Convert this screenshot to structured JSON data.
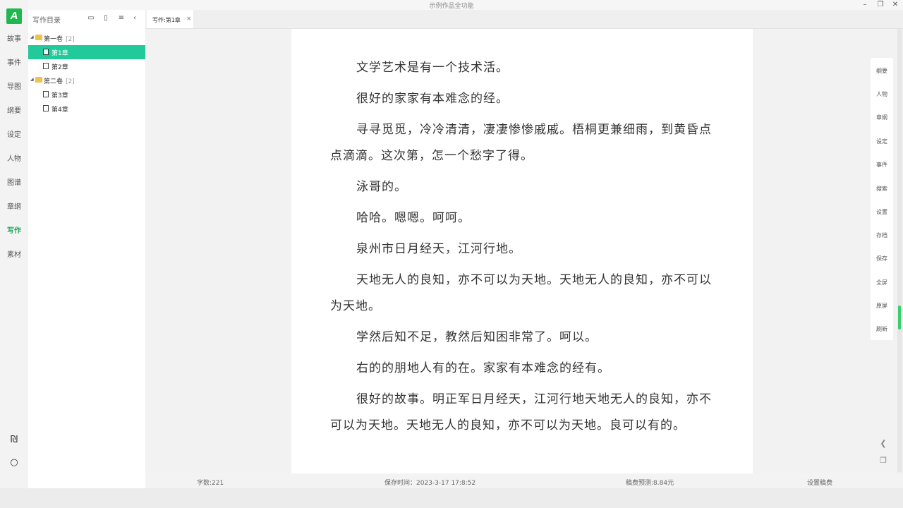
{
  "window": {
    "title": "示例作品全功能",
    "controls": [
      "minimize-icon",
      "restore-icon",
      "close-icon"
    ]
  },
  "rail": {
    "logo": "A",
    "items": [
      {
        "label": "故事"
      },
      {
        "label": "事件"
      },
      {
        "label": "导图"
      },
      {
        "label": "纲要"
      },
      {
        "label": "设定"
      },
      {
        "label": "人物"
      },
      {
        "label": "图谱"
      },
      {
        "label": "章纲"
      },
      {
        "label": "写作",
        "active": true
      },
      {
        "label": "素材"
      }
    ],
    "accent_color": "#21a85a"
  },
  "tree": {
    "title": "写作目录",
    "tools": [
      "folder-icon",
      "file-icon",
      "list-icon",
      "collapse-icon"
    ],
    "volumes": [
      {
        "label": "第一卷",
        "count": "[2]",
        "chapters": [
          "第1章",
          "第2章"
        ]
      },
      {
        "label": "第二卷",
        "count": "[2]",
        "chapters": [
          "第3章",
          "第4章"
        ]
      }
    ],
    "selected": "第1章",
    "selected_color": "#22c99a"
  },
  "tab": {
    "label": "写作:第1章",
    "close": "×"
  },
  "editor": {
    "paragraphs": [
      "文学艺术是有一个技术活。",
      "很好的家家有本难念的经。",
      "寻寻觅觅，冷冷清清，凄凄惨惨戚戚。梧桐更兼细雨，到黄昏点点滴滴。这次第，怎一个愁字了得。",
      "泳哥的。",
      "哈哈。嗯嗯。呵呵。",
      "泉州市日月经天，江河行地。",
      "天地无人的良知，亦不可以为天地。天地无人的良知，亦不可以为天地。",
      "学然后知不足，教然后知困非常了。呵以。",
      "右的的朋地人有的在。家家有本难念的经有。",
      "很好的故事。明正军日月经天，江河行地天地无人的良知，亦不可以为天地。天地无人的良知，亦不可以为天地。良可以有的。"
    ]
  },
  "side_tools": [
    "纲要",
    "人物",
    "章纲",
    "设定",
    "事件",
    "搜索",
    "设置",
    "存档",
    "保存",
    "全屏",
    "原屏",
    "刷新"
  ],
  "status": {
    "word_count": "字数:221",
    "save_time": "保存时间：2023-3-17 17:8:52",
    "fee_estimate": "稿费预测:8.84元",
    "set_fee": "设置稿费"
  }
}
